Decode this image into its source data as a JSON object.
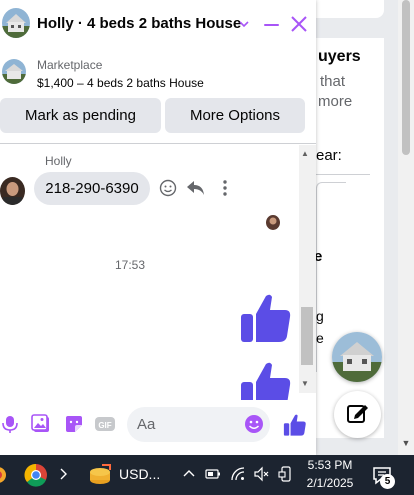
{
  "background": {
    "heading_fragment": "uyers",
    "sub_fragment_1": "that",
    "sub_fragment_2": "more",
    "label_fragment": "ear:",
    "e_fragment": "e",
    "g_fragment": "g",
    "e2_fragment": "e"
  },
  "chat": {
    "title": "Holly · 4 beds 2 baths House",
    "accent_color": "#a855f7",
    "marketplace": {
      "label": "Marketplace",
      "description": "$1,400 – 4 beds 2 baths House"
    },
    "buttons": {
      "mark_pending": "Mark as pending",
      "more_options": "More Options"
    },
    "messages": {
      "sender": "Holly",
      "phone": "218-290-6390",
      "time_separator": "17:53"
    },
    "composer": {
      "placeholder": "Aa",
      "gif_label": "GIF"
    },
    "like_color": "#5b4de6"
  },
  "taskbar": {
    "app_text": "USD...",
    "time": "5:53 PM",
    "date": "2/1/2025",
    "notification_count": "5"
  }
}
